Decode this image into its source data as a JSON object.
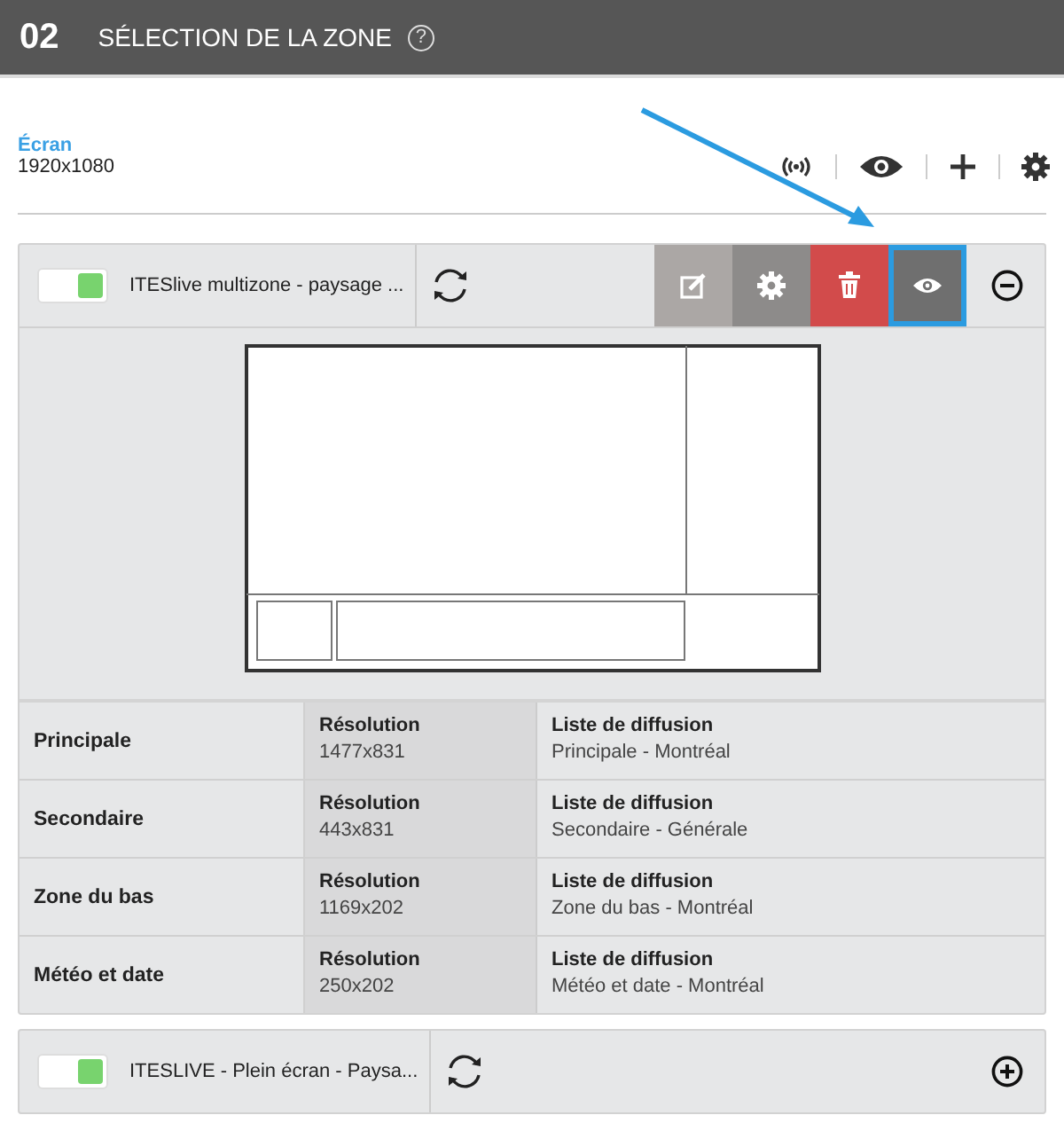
{
  "header": {
    "step": "02",
    "title": "SÉLECTION DE LA ZONE",
    "help": "?"
  },
  "screen": {
    "label": "Écran",
    "resolution": "1920x1080"
  },
  "toolbar": [
    {
      "kind": "broadcast"
    },
    {
      "kind": "eye"
    },
    {
      "kind": "plus"
    },
    {
      "kind": "gear"
    }
  ],
  "layouts": [
    {
      "name": "ITESlive multizone - paysage ...",
      "on": true,
      "expanded": true,
      "actions": [
        {
          "kind": "edit",
          "highlighted": false
        },
        {
          "kind": "settings",
          "highlighted": false
        },
        {
          "kind": "delete",
          "highlighted": false
        },
        {
          "kind": "preview",
          "highlighted": true
        }
      ],
      "zones": [
        {
          "name": "Principale",
          "resolution_label": "Résolution",
          "resolution": "1477x831",
          "playlist_label": "Liste de diffusion",
          "playlist": "Principale - Montréal"
        },
        {
          "name": "Secondaire",
          "resolution_label": "Résolution",
          "resolution": "443x831",
          "playlist_label": "Liste de diffusion",
          "playlist": "Secondaire - Générale"
        },
        {
          "name": "Zone du bas",
          "resolution_label": "Résolution",
          "resolution": "1169x202",
          "playlist_label": "Liste de diffusion",
          "playlist": "Zone du bas - Montréal"
        },
        {
          "name": "Météo et date",
          "resolution_label": "Résolution",
          "resolution": "250x202",
          "playlist_label": "Liste de diffusion",
          "playlist": "Météo et date - Montréal"
        }
      ]
    },
    {
      "name": "ITESLIVE - Plein écran - Paysa...",
      "on": true,
      "expanded": false
    }
  ]
}
